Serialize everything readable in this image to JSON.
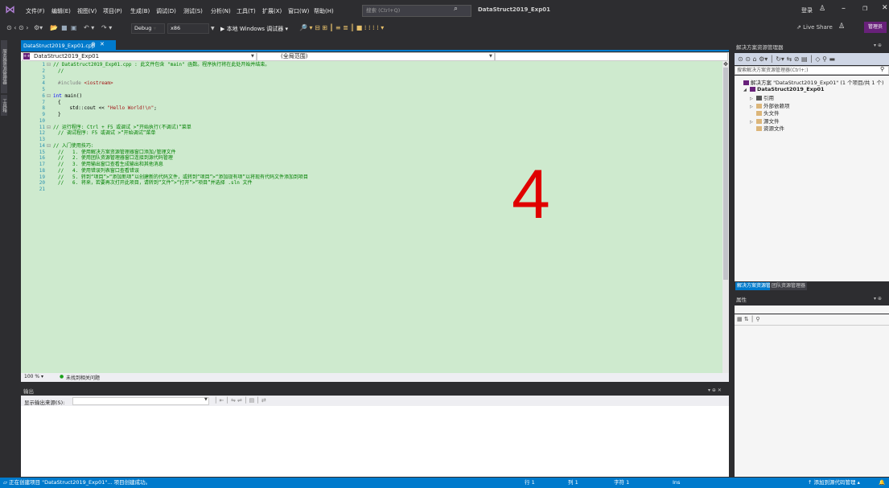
{
  "menubar": {
    "items": [
      "文件(F)",
      "编辑(E)",
      "视图(V)",
      "项目(P)",
      "生成(B)",
      "调试(D)",
      "测试(S)",
      "分析(N)",
      "工具(T)",
      "扩展(X)",
      "窗口(W)",
      "帮助(H)"
    ],
    "search_placeholder": "搜索 (Ctrl+Q)",
    "project_name": "DataStruct2019_Exp01",
    "login": "登录"
  },
  "toolbar": {
    "config": "Debug",
    "platform": "x86",
    "run_label": "▶ 本地 Windows 调试器",
    "live_share": "Live Share",
    "feedback": "管理员"
  },
  "left_strip": {
    "tab1": "服务器资源管理器",
    "tab2": "工具箱"
  },
  "editor": {
    "tab_label": "DataStruct2019_Exp01.cpp",
    "nav_project": "DataStruct2019_Exp01",
    "nav_scope": "(全局范围)",
    "zoom": "100 %",
    "issues": "未找到相关问题",
    "overlay_number": "4",
    "lines": [
      {
        "n": "1",
        "segs": [
          {
            "c": "cm",
            "t": "// DataStruct2019_Exp01.cpp : 此文件包含 \"main\" 函数。程序执行将在此处开始并结束。"
          }
        ],
        "fold": "⊟"
      },
      {
        "n": "2",
        "segs": [
          {
            "c": "cm",
            "t": "//"
          }
        ]
      },
      {
        "n": "3",
        "segs": []
      },
      {
        "n": "4",
        "segs": [
          {
            "c": "pp",
            "t": "#include "
          },
          {
            "c": "st",
            "t": "<iostream>"
          }
        ]
      },
      {
        "n": "5",
        "segs": []
      },
      {
        "n": "6",
        "segs": [
          {
            "c": "kw",
            "t": "int"
          },
          {
            "c": "tx",
            "t": " main()"
          }
        ],
        "fold": "⊟"
      },
      {
        "n": "7",
        "segs": [
          {
            "c": "tx",
            "t": "{"
          }
        ]
      },
      {
        "n": "8",
        "segs": [
          {
            "c": "tx",
            "t": "    std::cout << "
          },
          {
            "c": "st",
            "t": "\"Hello World!\\n\""
          },
          {
            "c": "tx",
            "t": ";"
          }
        ]
      },
      {
        "n": "9",
        "segs": [
          {
            "c": "tx",
            "t": "}"
          }
        ]
      },
      {
        "n": "10",
        "segs": []
      },
      {
        "n": "11",
        "segs": [
          {
            "c": "cm",
            "t": "// 运行程序: Ctrl + F5 或调试 >“开始执行(不调试)”菜单"
          }
        ],
        "fold": "⊟"
      },
      {
        "n": "12",
        "segs": [
          {
            "c": "cm",
            "t": "// 调试程序: F5 或调试 >“开始调试”菜单"
          }
        ]
      },
      {
        "n": "13",
        "segs": []
      },
      {
        "n": "14",
        "segs": [
          {
            "c": "cm",
            "t": "// 入门使用技巧:"
          }
        ],
        "fold": "⊟"
      },
      {
        "n": "15",
        "segs": [
          {
            "c": "cm",
            "t": "//   1. 使用解决方案资源管理器窗口添加/管理文件"
          }
        ]
      },
      {
        "n": "16",
        "segs": [
          {
            "c": "cm",
            "t": "//   2. 使用团队资源管理器窗口连接到源代码管理"
          }
        ]
      },
      {
        "n": "17",
        "segs": [
          {
            "c": "cm",
            "t": "//   3. 使用输出窗口查看生成输出和其他消息"
          }
        ]
      },
      {
        "n": "18",
        "segs": [
          {
            "c": "cm",
            "t": "//   4. 使用错误列表窗口查看错误"
          }
        ]
      },
      {
        "n": "19",
        "segs": [
          {
            "c": "cm",
            "t": "//   5. 转到“项目”>“添加新项”以创建新的代码文件，或转到“项目”>“添加现有项”以将现有代码文件添加到项目"
          }
        ]
      },
      {
        "n": "20",
        "segs": [
          {
            "c": "cm",
            "t": "//   6. 将来，若要再次打开此项目，请转到“文件”>“打开”>“项目”并选择 .sln 文件"
          }
        ]
      },
      {
        "n": "21",
        "segs": []
      }
    ]
  },
  "output": {
    "title": "输出",
    "source_label": "显示输出来源(S):"
  },
  "solution_explorer": {
    "title": "解决方案资源管理器",
    "search_placeholder": "搜索解决方案资源管理器(Ctrl+;)",
    "tree": [
      {
        "label": "解决方案 \"DataStruct2019_Exp01\" (1 个项目/共 1 个)",
        "indent": 0,
        "arrow": "",
        "icon_color": "#68217a"
      },
      {
        "label": "DataStruct2019_Exp01",
        "indent": 1,
        "arrow": "◢",
        "icon_color": "#68217a",
        "bold": true
      },
      {
        "label": "引用",
        "indent": 2,
        "arrow": "▷",
        "icon_color": "#555555"
      },
      {
        "label": "外部依赖项",
        "indent": 2,
        "arrow": "▷",
        "icon_color": "#dcb67a"
      },
      {
        "label": "头文件",
        "indent": 2,
        "arrow": "",
        "icon_color": "#dcb67a"
      },
      {
        "label": "源文件",
        "indent": 2,
        "arrow": "▷",
        "icon_color": "#dcb67a"
      },
      {
        "label": "资源文件",
        "indent": 2,
        "arrow": "",
        "icon_color": "#dcb67a"
      }
    ],
    "tab1": "解决方案资源管理器",
    "tab2": "团队资源管理器"
  },
  "properties": {
    "title": "属性"
  },
  "statusbar": {
    "message": "正在创建项目 \"DataStruct2019_Exp01\"... 项目创建成功。",
    "row": "行 1",
    "col": "列 1",
    "ch": "字符 1",
    "ins": "Ins",
    "source_control": "添加到源代码管理"
  }
}
